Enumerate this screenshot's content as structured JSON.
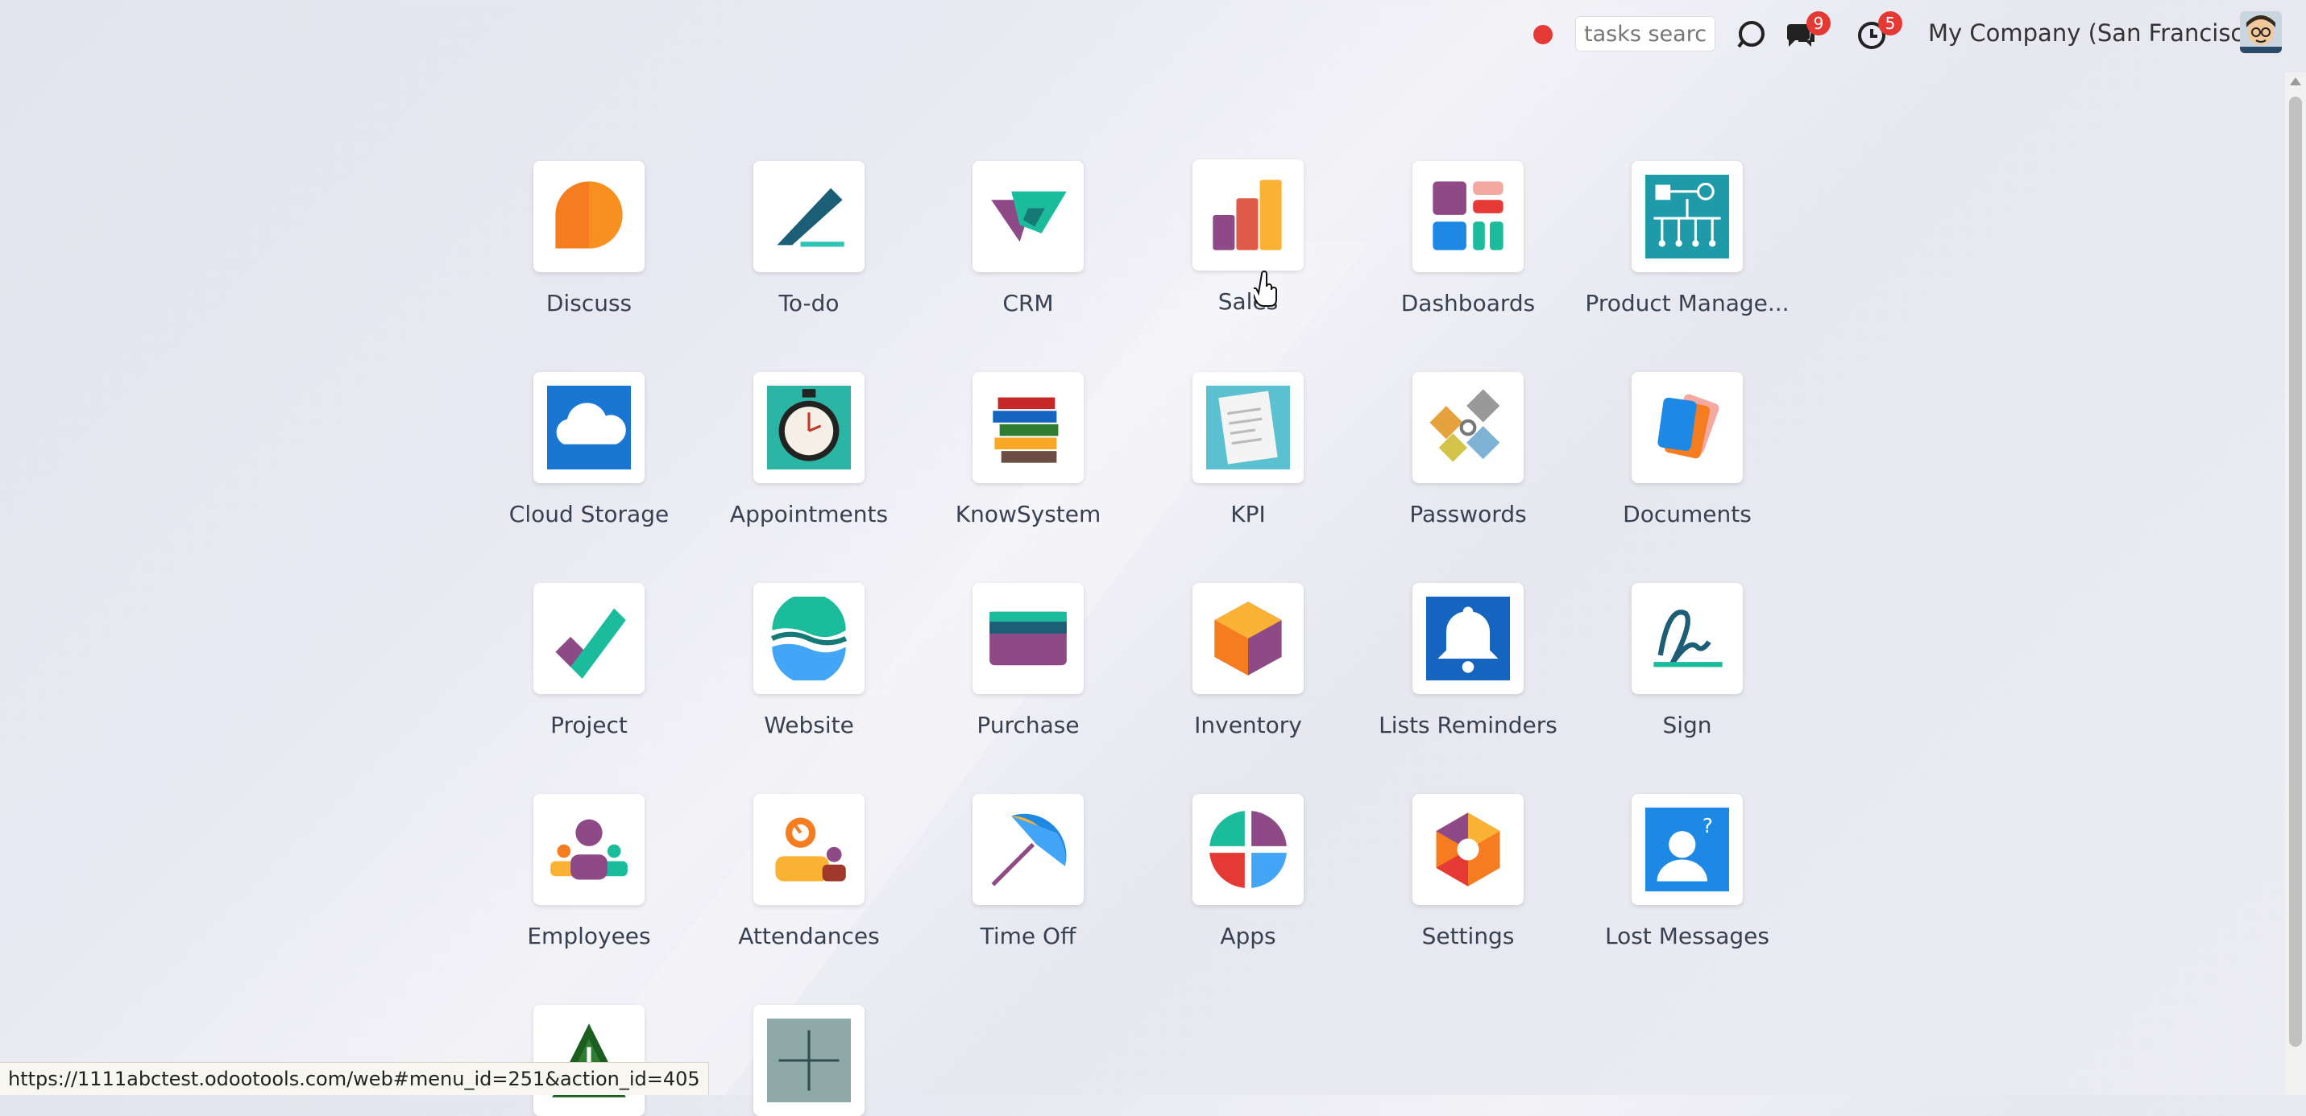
{
  "topbar": {
    "search_placeholder": "tasks search",
    "messages_badge": "9",
    "activities_badge": "5",
    "company": "My Company (San Francisco)",
    "icons": [
      "record-dot",
      "odoobot-icon",
      "chat-icon",
      "clock-icon",
      "user-avatar"
    ]
  },
  "apps": [
    {
      "label": "Discuss"
    },
    {
      "label": "To-do"
    },
    {
      "label": "CRM"
    },
    {
      "label": "Sales"
    },
    {
      "label": "Dashboards"
    },
    {
      "label": "Product Manage..."
    },
    {
      "label": "Cloud Storage"
    },
    {
      "label": "Appointments"
    },
    {
      "label": "KnowSystem"
    },
    {
      "label": "KPI"
    },
    {
      "label": "Passwords"
    },
    {
      "label": "Documents"
    },
    {
      "label": "Project"
    },
    {
      "label": "Website"
    },
    {
      "label": "Purchase"
    },
    {
      "label": "Inventory"
    },
    {
      "label": "Lists Reminders"
    },
    {
      "label": "Sign"
    },
    {
      "label": "Employees"
    },
    {
      "label": "Attendances"
    },
    {
      "label": "Time Off"
    },
    {
      "label": "Apps"
    },
    {
      "label": "Settings"
    },
    {
      "label": "Lost Messages"
    }
  ],
  "status_url": "https://1111abctest.odootools.com/web#menu_id=251&action_id=405",
  "colors": {
    "badge": "#e53935",
    "accent_purple": "#8e4a87",
    "accent_teal": "#1abc9c"
  }
}
